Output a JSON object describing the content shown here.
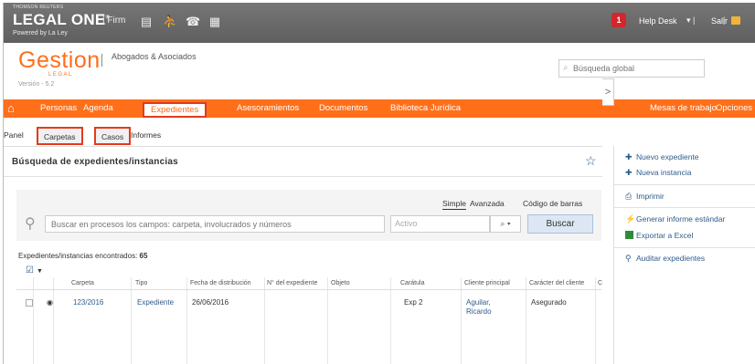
{
  "topbar": {
    "brand_small": "THOMSON REUTERS",
    "product": "LEGAL ONE",
    "edition": "Firm",
    "powered_by": "Powered by La Ley",
    "notification_count": "1",
    "help_desk": "Help Desk",
    "logout": "Salir",
    "icons": [
      "books-icon",
      "people-icon",
      "phone-icon",
      "calendar-icon"
    ]
  },
  "header": {
    "app_name": "Gestion",
    "app_sub": "LEGAL",
    "firm_name": "Abogados & Asociados",
    "version": "Versión - 5.2",
    "global_search_placeholder": "Búsqueda global"
  },
  "nav": {
    "items": [
      "Personas",
      "Agenda",
      "Expedientes",
      "Asesoramientos",
      "Documentos",
      "Biblioteca Jurídica"
    ],
    "right_items": [
      "Mesas de trabajo",
      "Opciones"
    ],
    "active": "Expedientes"
  },
  "subnav": {
    "items": [
      "Panel",
      "Carpetas",
      "Casos",
      "Informes"
    ],
    "highlighted": [
      "Carpetas",
      "Casos"
    ]
  },
  "panel": {
    "title": "Búsqueda de expedientes/instancias",
    "search_tabs": [
      "Simple",
      "Avanzada",
      "Código de barras"
    ],
    "search_placeholder": "Buscar en procesos los campos: carpeta, involucrados y números",
    "status_value": "Activo",
    "search_button": "Buscar",
    "found_label": "Expedientes/instancias encontrados:",
    "found_count": "65"
  },
  "table": {
    "columns": [
      "Carpeta",
      "Tipo",
      "Fecha de distribución",
      "N° del expediente",
      "Objeto",
      "Carátula",
      "Cliente principal",
      "Carácter del cliente",
      "C"
    ],
    "rows": [
      {
        "carpeta": "123/2016",
        "tipo": "Expediente",
        "fecha": "26/06/2016",
        "numero": "",
        "objeto": "",
        "caratula": "Exp 2",
        "cliente_line1": "Aguilar,",
        "cliente_line2": "Ricardo",
        "caracter": "Asegurado"
      }
    ]
  },
  "side": {
    "items": [
      "Nuevo expediente",
      "Nueva instancia",
      "Imprimir",
      "Generar informe estándar",
      "Exportar a Excel",
      "Auditar expedientes"
    ]
  },
  "colors": {
    "accent": "#ff6f1a",
    "highlight_border": "#e23b1c",
    "link": "#2f5b8c",
    "topbar": "#6d6d6d"
  }
}
